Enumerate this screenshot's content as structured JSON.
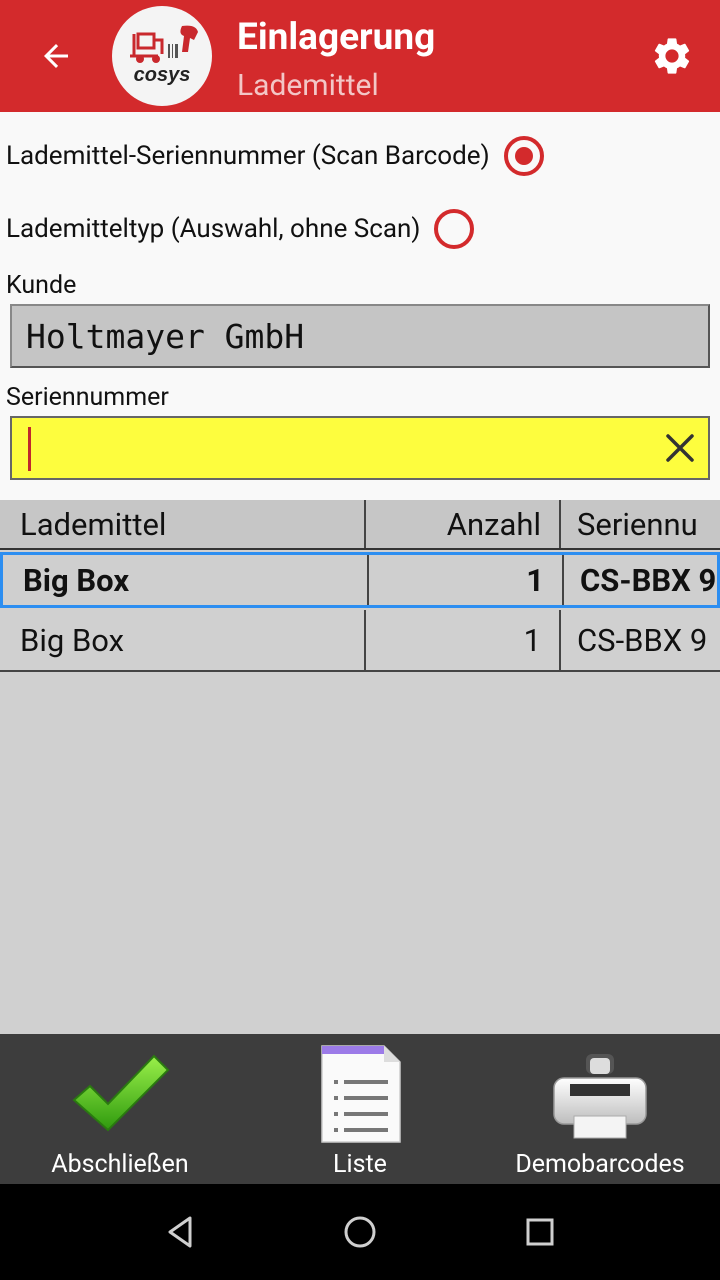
{
  "appbar": {
    "title": "Einlagerung",
    "subtitle": "Lademittel",
    "back_icon": "arrow-back-icon",
    "settings_icon": "gear-icon",
    "logo_text": "cosys",
    "color": "#d32a2c"
  },
  "mode": {
    "option_serial": {
      "label": "Lademittel-Seriennummer (Scan Barcode)",
      "selected": true
    },
    "option_type": {
      "label": "Lademitteltyp (Auswahl, ohne Scan)",
      "selected": false
    }
  },
  "kunde": {
    "label": "Kunde",
    "value": "Holtmayer GmbH"
  },
  "serial": {
    "label": "Seriennummer",
    "value": "",
    "background": "#fdfd3e",
    "clear_icon": "close-icon"
  },
  "table": {
    "columns": [
      "Lademittel",
      "Anzahl",
      "Seriennu"
    ],
    "rows": [
      {
        "lademittel": "Big Box",
        "anzahl": "1",
        "seriennummer": "CS-BBX 9"
      },
      {
        "lademittel": "Big Box",
        "anzahl": "1",
        "seriennummer": "CS-BBX 9"
      }
    ],
    "selected_row": 0,
    "selection_color": "#2c8ef1"
  },
  "bottombar": {
    "finish": {
      "label": "Abschließen",
      "icon": "check-icon"
    },
    "list": {
      "label": "Liste",
      "icon": "document-list-icon"
    },
    "demo": {
      "label": "Demobarcodes",
      "icon": "printer-icon"
    }
  },
  "navbar": {
    "back_icon": "nav-back-icon",
    "home_icon": "nav-home-icon",
    "recents_icon": "nav-recents-icon"
  }
}
